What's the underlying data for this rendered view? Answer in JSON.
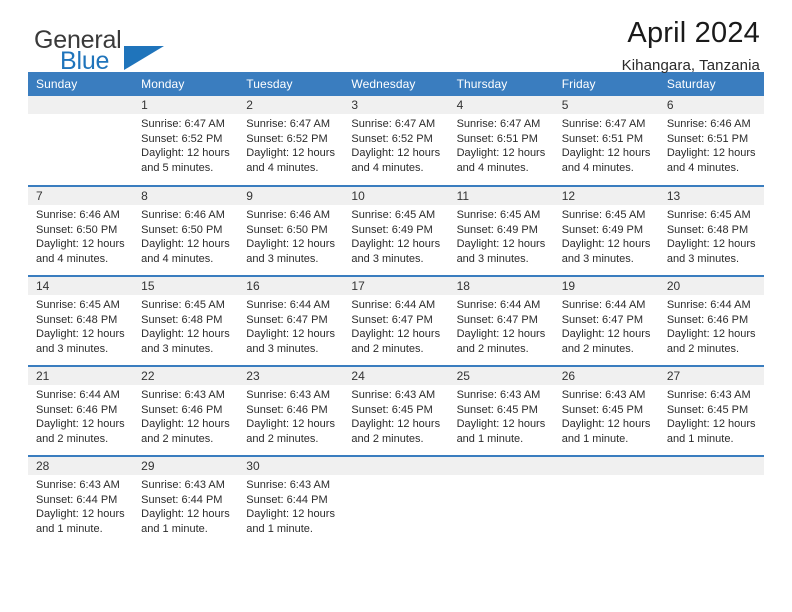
{
  "brand": {
    "name_top": "General",
    "name_bottom": "Blue",
    "accent_color": "#1f74bb",
    "logo_icon": "triangle-logo-icon"
  },
  "header": {
    "title": "April 2024",
    "subtitle": "Kihangara, Tanzania"
  },
  "theme": {
    "header_bg": "#3a7dbf",
    "daynum_bg": "#f0f0f0",
    "row_rule": "#3a7dbf",
    "text": "#2b2b2b"
  },
  "weekday_headers": [
    "Sunday",
    "Monday",
    "Tuesday",
    "Wednesday",
    "Thursday",
    "Friday",
    "Saturday"
  ],
  "weeks": [
    [
      {
        "day": "",
        "sunrise": "",
        "sunset": "",
        "daylight_1": "",
        "daylight_2": ""
      },
      {
        "day": "1",
        "sunrise": "Sunrise: 6:47 AM",
        "sunset": "Sunset: 6:52 PM",
        "daylight_1": "Daylight: 12 hours",
        "daylight_2": "and 5 minutes."
      },
      {
        "day": "2",
        "sunrise": "Sunrise: 6:47 AM",
        "sunset": "Sunset: 6:52 PM",
        "daylight_1": "Daylight: 12 hours",
        "daylight_2": "and 4 minutes."
      },
      {
        "day": "3",
        "sunrise": "Sunrise: 6:47 AM",
        "sunset": "Sunset: 6:52 PM",
        "daylight_1": "Daylight: 12 hours",
        "daylight_2": "and 4 minutes."
      },
      {
        "day": "4",
        "sunrise": "Sunrise: 6:47 AM",
        "sunset": "Sunset: 6:51 PM",
        "daylight_1": "Daylight: 12 hours",
        "daylight_2": "and 4 minutes."
      },
      {
        "day": "5",
        "sunrise": "Sunrise: 6:47 AM",
        "sunset": "Sunset: 6:51 PM",
        "daylight_1": "Daylight: 12 hours",
        "daylight_2": "and 4 minutes."
      },
      {
        "day": "6",
        "sunrise": "Sunrise: 6:46 AM",
        "sunset": "Sunset: 6:51 PM",
        "daylight_1": "Daylight: 12 hours",
        "daylight_2": "and 4 minutes."
      }
    ],
    [
      {
        "day": "7",
        "sunrise": "Sunrise: 6:46 AM",
        "sunset": "Sunset: 6:50 PM",
        "daylight_1": "Daylight: 12 hours",
        "daylight_2": "and 4 minutes."
      },
      {
        "day": "8",
        "sunrise": "Sunrise: 6:46 AM",
        "sunset": "Sunset: 6:50 PM",
        "daylight_1": "Daylight: 12 hours",
        "daylight_2": "and 4 minutes."
      },
      {
        "day": "9",
        "sunrise": "Sunrise: 6:46 AM",
        "sunset": "Sunset: 6:50 PM",
        "daylight_1": "Daylight: 12 hours",
        "daylight_2": "and 3 minutes."
      },
      {
        "day": "10",
        "sunrise": "Sunrise: 6:45 AM",
        "sunset": "Sunset: 6:49 PM",
        "daylight_1": "Daylight: 12 hours",
        "daylight_2": "and 3 minutes."
      },
      {
        "day": "11",
        "sunrise": "Sunrise: 6:45 AM",
        "sunset": "Sunset: 6:49 PM",
        "daylight_1": "Daylight: 12 hours",
        "daylight_2": "and 3 minutes."
      },
      {
        "day": "12",
        "sunrise": "Sunrise: 6:45 AM",
        "sunset": "Sunset: 6:49 PM",
        "daylight_1": "Daylight: 12 hours",
        "daylight_2": "and 3 minutes."
      },
      {
        "day": "13",
        "sunrise": "Sunrise: 6:45 AM",
        "sunset": "Sunset: 6:48 PM",
        "daylight_1": "Daylight: 12 hours",
        "daylight_2": "and 3 minutes."
      }
    ],
    [
      {
        "day": "14",
        "sunrise": "Sunrise: 6:45 AM",
        "sunset": "Sunset: 6:48 PM",
        "daylight_1": "Daylight: 12 hours",
        "daylight_2": "and 3 minutes."
      },
      {
        "day": "15",
        "sunrise": "Sunrise: 6:45 AM",
        "sunset": "Sunset: 6:48 PM",
        "daylight_1": "Daylight: 12 hours",
        "daylight_2": "and 3 minutes."
      },
      {
        "day": "16",
        "sunrise": "Sunrise: 6:44 AM",
        "sunset": "Sunset: 6:47 PM",
        "daylight_1": "Daylight: 12 hours",
        "daylight_2": "and 3 minutes."
      },
      {
        "day": "17",
        "sunrise": "Sunrise: 6:44 AM",
        "sunset": "Sunset: 6:47 PM",
        "daylight_1": "Daylight: 12 hours",
        "daylight_2": "and 2 minutes."
      },
      {
        "day": "18",
        "sunrise": "Sunrise: 6:44 AM",
        "sunset": "Sunset: 6:47 PM",
        "daylight_1": "Daylight: 12 hours",
        "daylight_2": "and 2 minutes."
      },
      {
        "day": "19",
        "sunrise": "Sunrise: 6:44 AM",
        "sunset": "Sunset: 6:47 PM",
        "daylight_1": "Daylight: 12 hours",
        "daylight_2": "and 2 minutes."
      },
      {
        "day": "20",
        "sunrise": "Sunrise: 6:44 AM",
        "sunset": "Sunset: 6:46 PM",
        "daylight_1": "Daylight: 12 hours",
        "daylight_2": "and 2 minutes."
      }
    ],
    [
      {
        "day": "21",
        "sunrise": "Sunrise: 6:44 AM",
        "sunset": "Sunset: 6:46 PM",
        "daylight_1": "Daylight: 12 hours",
        "daylight_2": "and 2 minutes."
      },
      {
        "day": "22",
        "sunrise": "Sunrise: 6:43 AM",
        "sunset": "Sunset: 6:46 PM",
        "daylight_1": "Daylight: 12 hours",
        "daylight_2": "and 2 minutes."
      },
      {
        "day": "23",
        "sunrise": "Sunrise: 6:43 AM",
        "sunset": "Sunset: 6:46 PM",
        "daylight_1": "Daylight: 12 hours",
        "daylight_2": "and 2 minutes."
      },
      {
        "day": "24",
        "sunrise": "Sunrise: 6:43 AM",
        "sunset": "Sunset: 6:45 PM",
        "daylight_1": "Daylight: 12 hours",
        "daylight_2": "and 2 minutes."
      },
      {
        "day": "25",
        "sunrise": "Sunrise: 6:43 AM",
        "sunset": "Sunset: 6:45 PM",
        "daylight_1": "Daylight: 12 hours",
        "daylight_2": "and 1 minute."
      },
      {
        "day": "26",
        "sunrise": "Sunrise: 6:43 AM",
        "sunset": "Sunset: 6:45 PM",
        "daylight_1": "Daylight: 12 hours",
        "daylight_2": "and 1 minute."
      },
      {
        "day": "27",
        "sunrise": "Sunrise: 6:43 AM",
        "sunset": "Sunset: 6:45 PM",
        "daylight_1": "Daylight: 12 hours",
        "daylight_2": "and 1 minute."
      }
    ],
    [
      {
        "day": "28",
        "sunrise": "Sunrise: 6:43 AM",
        "sunset": "Sunset: 6:44 PM",
        "daylight_1": "Daylight: 12 hours",
        "daylight_2": "and 1 minute."
      },
      {
        "day": "29",
        "sunrise": "Sunrise: 6:43 AM",
        "sunset": "Sunset: 6:44 PM",
        "daylight_1": "Daylight: 12 hours",
        "daylight_2": "and 1 minute."
      },
      {
        "day": "30",
        "sunrise": "Sunrise: 6:43 AM",
        "sunset": "Sunset: 6:44 PM",
        "daylight_1": "Daylight: 12 hours",
        "daylight_2": "and 1 minute."
      },
      {
        "day": "",
        "sunrise": "",
        "sunset": "",
        "daylight_1": "",
        "daylight_2": ""
      },
      {
        "day": "",
        "sunrise": "",
        "sunset": "",
        "daylight_1": "",
        "daylight_2": ""
      },
      {
        "day": "",
        "sunrise": "",
        "sunset": "",
        "daylight_1": "",
        "daylight_2": ""
      },
      {
        "day": "",
        "sunrise": "",
        "sunset": "",
        "daylight_1": "",
        "daylight_2": ""
      }
    ]
  ]
}
